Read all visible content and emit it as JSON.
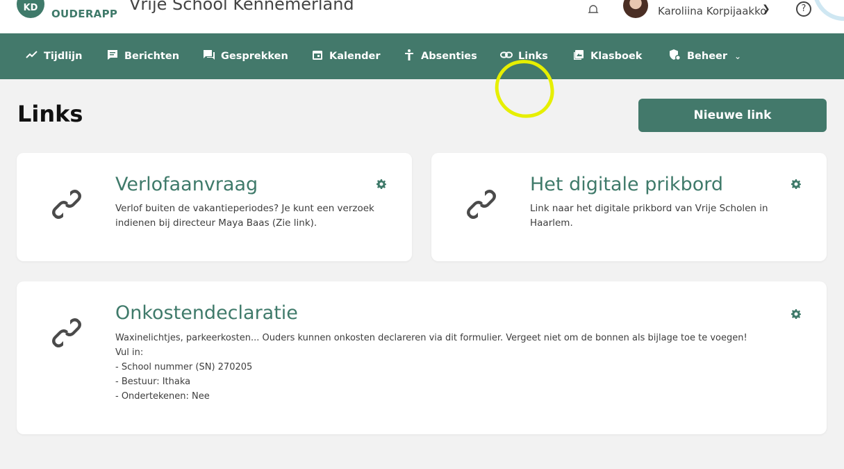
{
  "header": {
    "logo_badge": "KD",
    "logo_text": "OUDERAPP",
    "school_name": "Vrije School Kennemerland",
    "user_name": "Karoliina Korpijaakko",
    "help_symbol": "?"
  },
  "nav": {
    "items": [
      {
        "label": "Tijdlijn",
        "icon": "trend-icon"
      },
      {
        "label": "Berichten",
        "icon": "message-icon"
      },
      {
        "label": "Gesprekken",
        "icon": "conversation-icon"
      },
      {
        "label": "Kalender",
        "icon": "calendar-icon"
      },
      {
        "label": "Absenties",
        "icon": "person-icon"
      },
      {
        "label": "Links",
        "icon": "link-icon"
      },
      {
        "label": "Klasboek",
        "icon": "book-icon"
      },
      {
        "label": "Beheer",
        "icon": "admin-icon"
      }
    ],
    "highlight_color": "#e6ef00"
  },
  "page": {
    "title": "Links",
    "new_link_button": "Nieuwe link"
  },
  "cards": [
    {
      "title": "Verlofaanvraag",
      "description": "Verlof buiten de vakantieperiodes? Je kunt een verzoek\nindienen bij directeur Maya Baas (Zie link)."
    },
    {
      "title": "Het digitale prikbord",
      "description": "Link naar het digitale prikbord van Vrije Scholen in\nHaarlem."
    },
    {
      "title": "Onkostendeclaratie",
      "description": "Waxinelichtjes, parkeerkosten... Ouders kunnen onkosten declareren via dit formulier. Vergeet niet om de bonnen als bijlage toe te voegen!\nVul in:\n- School nummer (SN) 270205\n- Bestuur: Ithaka\n- Ondertekenen: Nee"
    }
  ],
  "colors": {
    "brand": "#43796b",
    "title_green": "#3f7a6a",
    "background": "#f2f2f2"
  }
}
